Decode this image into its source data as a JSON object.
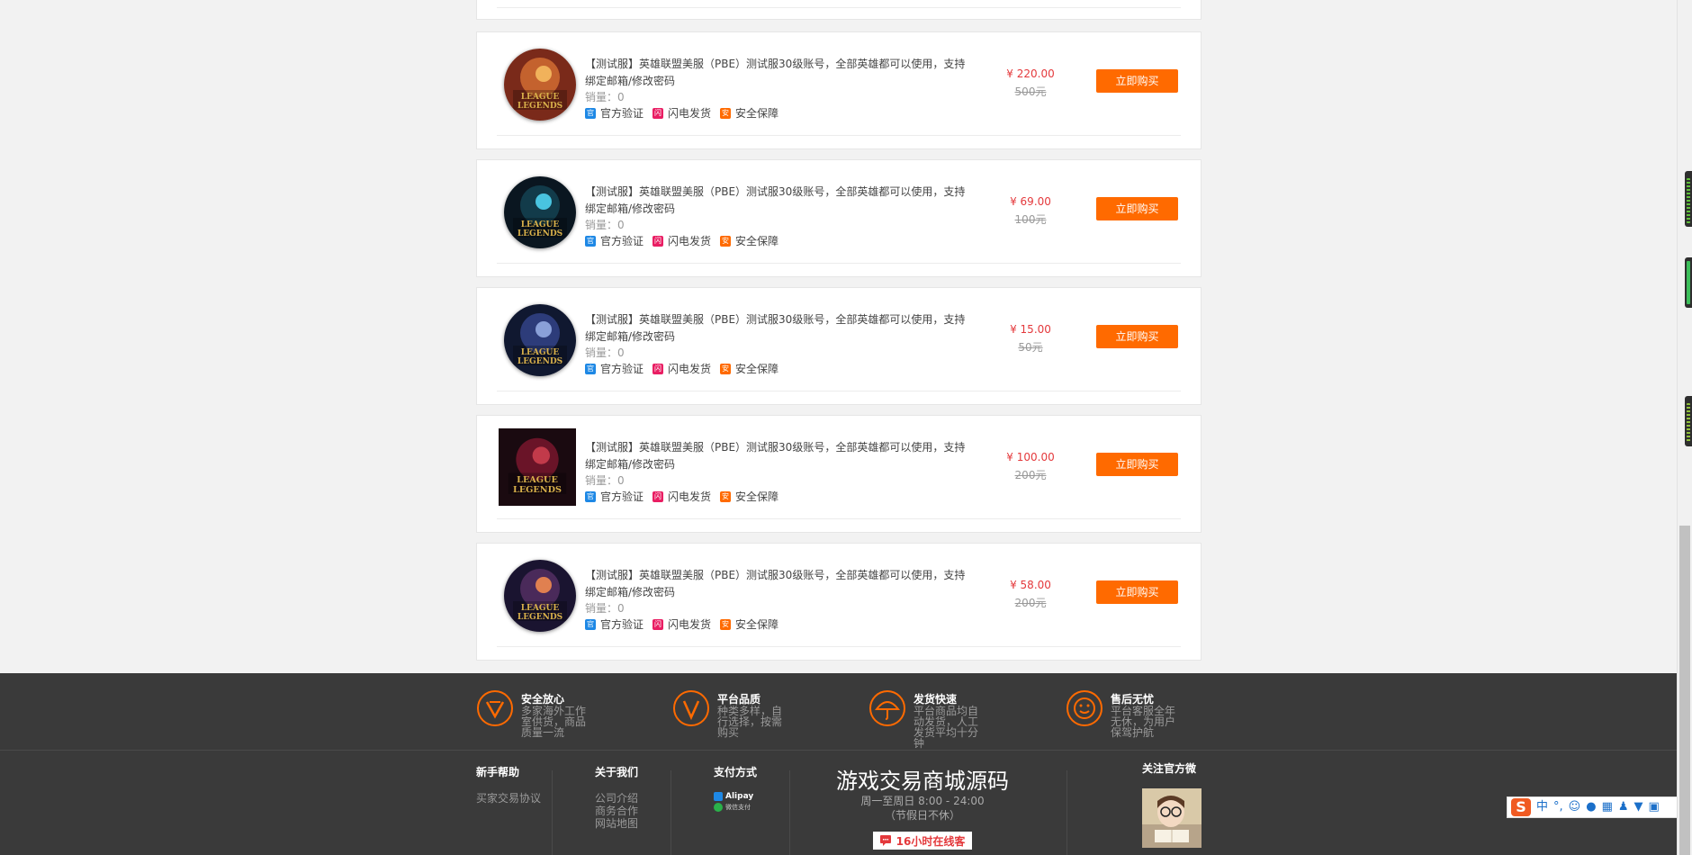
{
  "products": [
    {
      "title": "【测试服】英雄联盟美服（PBE）测试服30级账号，全部英雄都可以使用，支持绑定邮箱/修改密码",
      "sales": "销量：0",
      "price": "¥ 220.00",
      "original_price": "500元",
      "buy_label": "立即购买",
      "image": "round"
    },
    {
      "title": "【测试服】英雄联盟美服（PBE）测试服30级账号，全部英雄都可以使用，支持绑定邮箱/修改密码",
      "sales": "销量：0",
      "price": "¥ 69.00",
      "original_price": "100元",
      "buy_label": "立即购买",
      "image": "round"
    },
    {
      "title": "【测试服】英雄联盟美服（PBE）测试服30级账号，全部英雄都可以使用，支持绑定邮箱/修改密码",
      "sales": "销量：0",
      "price": "¥ 15.00",
      "original_price": "50元",
      "buy_label": "立即购买",
      "image": "round"
    },
    {
      "title": "【测试服】英雄联盟美服（PBE）测试服30级账号，全部英雄都可以使用，支持绑定邮箱/修改密码",
      "sales": "销量：0",
      "price": "¥ 100.00",
      "original_price": "200元",
      "buy_label": "立即购买",
      "image": "square"
    },
    {
      "title": "【测试服】英雄联盟美服（PBE）测试服30级账号，全部英雄都可以使用，支持绑定邮箱/修改密码",
      "sales": "销量：0",
      "price": "¥ 58.00",
      "original_price": "200元",
      "buy_label": "立即购买",
      "image": "round"
    }
  ],
  "tags": [
    {
      "icon_text": "官",
      "label": "官方验证",
      "color": "#1e88e5"
    },
    {
      "icon_text": "闪",
      "label": "闪电发货",
      "color": "#e91e63"
    },
    {
      "icon_text": "安",
      "label": "安全保障",
      "color": "#ff6a00"
    }
  ],
  "logo_text": "LEAGUE LEGENDS",
  "features": [
    {
      "title": "安全放心",
      "desc": "多家海外工作室供货，商品质量一流",
      "icon": "shield-v-icon"
    },
    {
      "title": "平台品质",
      "desc": "种类多样，自行选择，按需购买",
      "icon": "quality-v-icon"
    },
    {
      "title": "发货快速",
      "desc": "平台商品均自动发货，人工发货平均十分钟",
      "icon": "umbrella-icon"
    },
    {
      "title": "售后无忧",
      "desc": "平台客服全年无休，为用户保驾护航",
      "icon": "smile-icon"
    }
  ],
  "footer": {
    "help": {
      "title": "新手帮助",
      "links": [
        "买家交易协议"
      ]
    },
    "about": {
      "title": "关于我们",
      "links": [
        "公司介绍",
        "商务合作",
        "网站地图"
      ]
    },
    "pay": {
      "title": "支付方式",
      "alipay": "Alipay",
      "wechat": "微信支付"
    },
    "brand_title": "游戏交易商城源码",
    "hours": "周一至周日 8:00 - 24:00",
    "holiday": "（节假日不休）",
    "online_label": "16小时在线客",
    "follow_title": "关注官方微"
  },
  "ime": {
    "logo": "S",
    "lang": "中",
    "punct": "°,"
  },
  "colors": {
    "accent": "#ff6a00",
    "price": "#e4393c",
    "footer_bg": "#3a3a3a"
  }
}
